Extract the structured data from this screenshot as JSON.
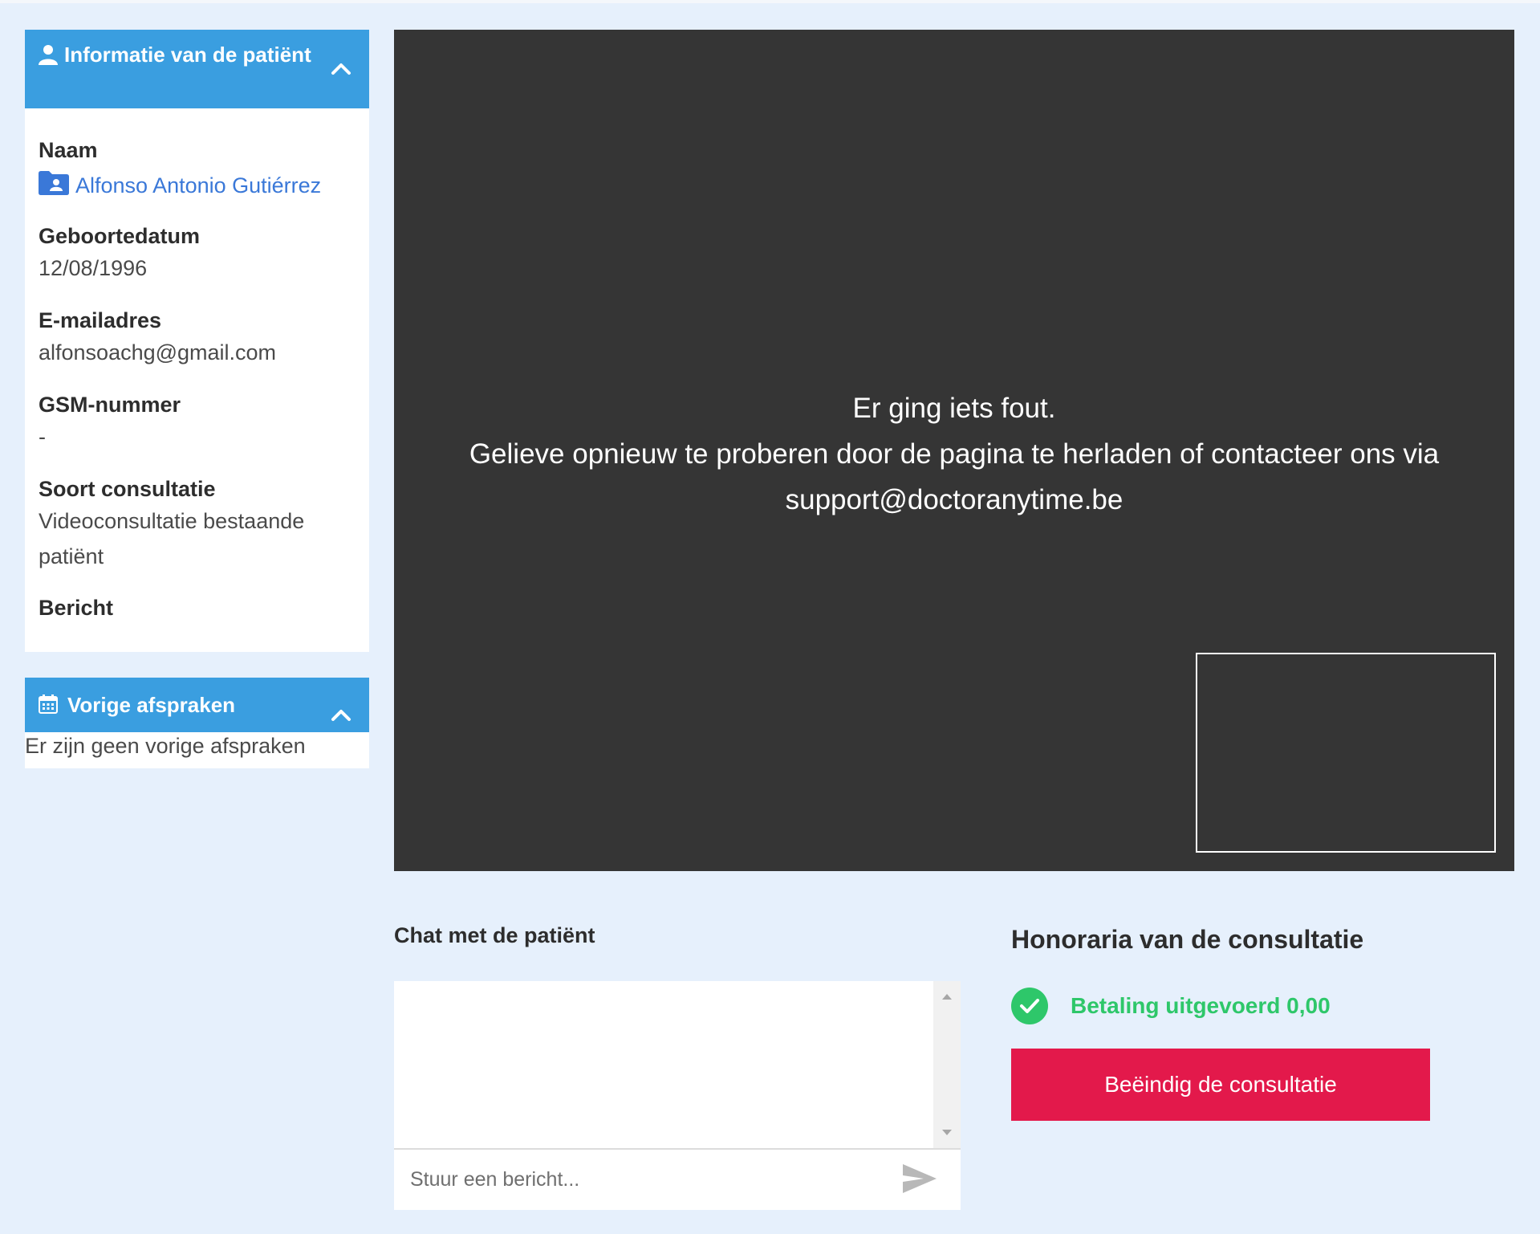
{
  "patient_panel": {
    "title": "Informatie van de patiënt",
    "name_label": "Naam",
    "name_value": "Alfonso Antonio Gutiérrez",
    "dob_label": "Geboortedatum",
    "dob_value": "12/08/1996",
    "email_label": "E-mailadres",
    "email_value": "alfonsoachg@gmail.com",
    "phone_label": "GSM-nummer",
    "phone_value": "-",
    "consult_type_label": "Soort consultatie",
    "consult_type_value_line1": "Videoconsultatie bestaande",
    "consult_type_value_line2": "patiënt",
    "message_label": "Bericht"
  },
  "history_panel": {
    "title": "Vorige afspraken",
    "empty_text": "Er zijn geen vorige afspraken"
  },
  "video": {
    "error_line1": "Er ging iets fout.",
    "error_line2": "Gelieve opnieuw te proberen door de pagina te herladen of contacteer ons via",
    "error_line3": "support@doctoranytime.be"
  },
  "chat": {
    "title": "Chat met de patiënt",
    "input_placeholder": "Stuur een bericht..."
  },
  "fees": {
    "title": "Honoraria van de consultatie",
    "payment_status": "Betaling uitgevoerd 0,00",
    "end_button_label": "Beëindig de consultatie"
  },
  "icons": {
    "patient_header": "user-icon",
    "collapse": "chevron-up-icon",
    "patient_file": "folder-user-icon",
    "history_header": "calendar-icon",
    "send": "send-icon",
    "payment_ok": "check-circle-icon"
  },
  "colors": {
    "page_background": "#e6f0fc",
    "panel_header": "#3a9ee0",
    "link": "#3a78d8",
    "video_background": "#353535",
    "success": "#2ec76a",
    "danger_button": "#e3194b"
  }
}
